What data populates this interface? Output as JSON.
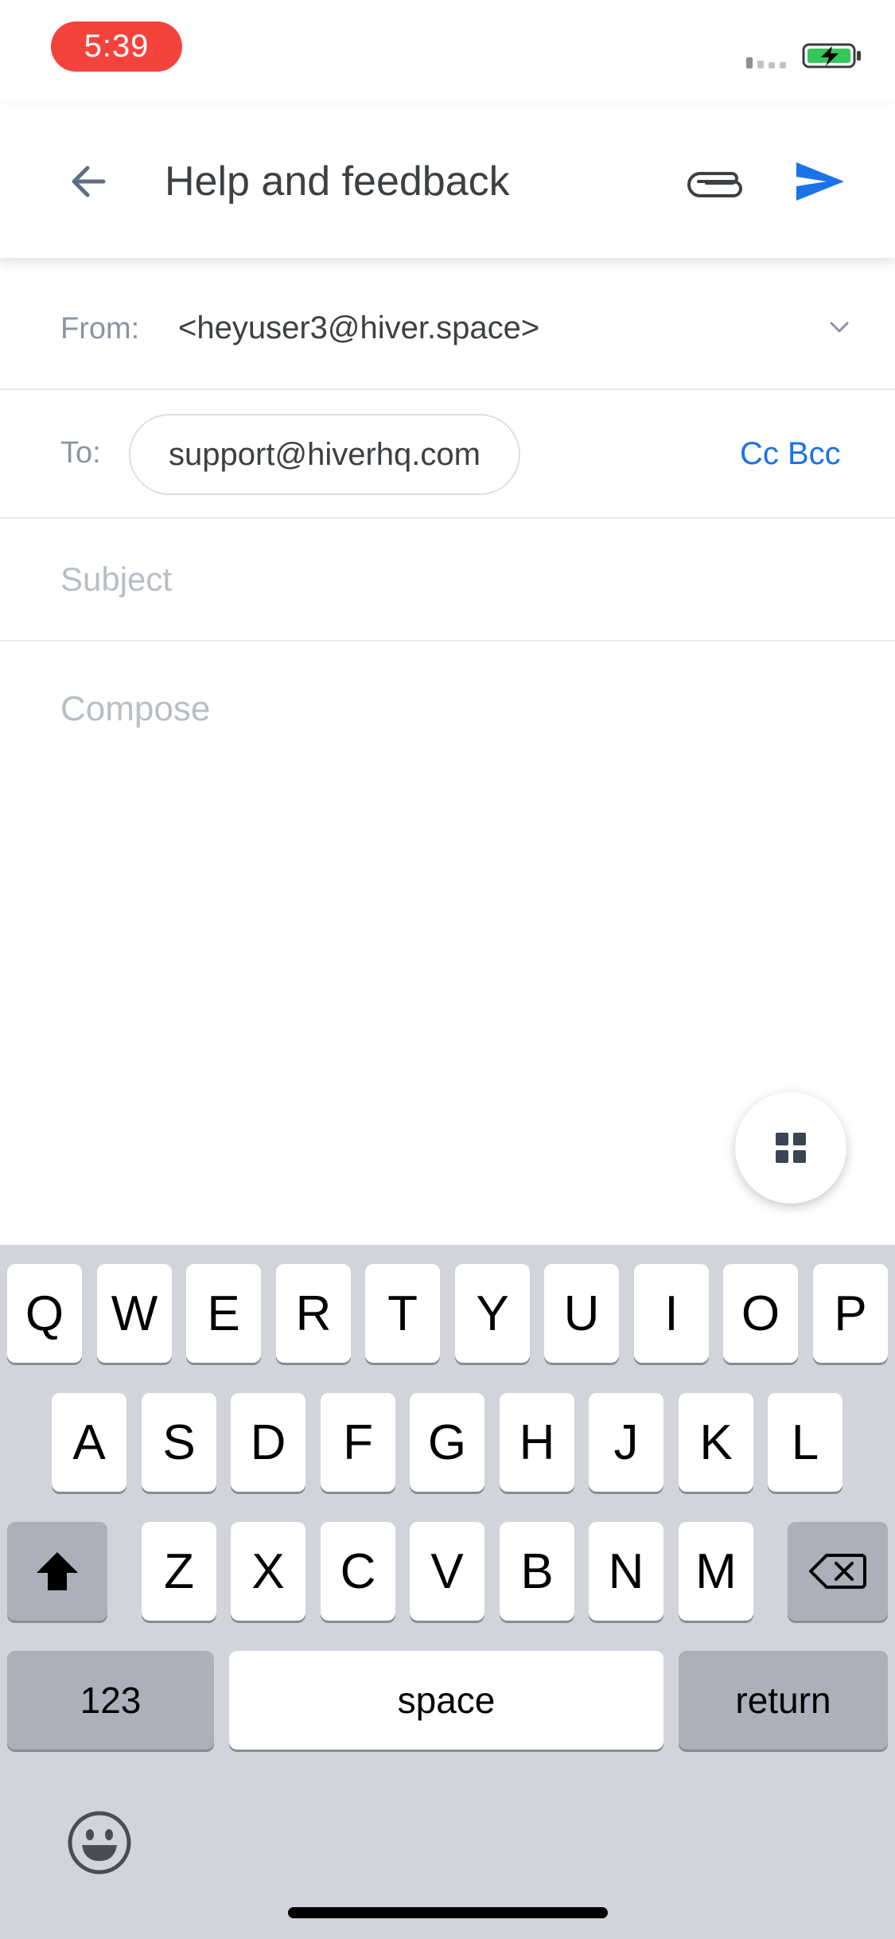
{
  "status_bar": {
    "time": "5:39"
  },
  "app_bar": {
    "title": "Help and feedback"
  },
  "from": {
    "label": "From:",
    "value": "<heyuser3@hiver.space>"
  },
  "to": {
    "label": "To:",
    "recipient": "support@hiverhq.com",
    "cc_bcc": "Cc Bcc"
  },
  "subject": {
    "placeholder": "Subject"
  },
  "compose": {
    "placeholder": "Compose"
  },
  "keyboard": {
    "row1": [
      "Q",
      "W",
      "E",
      "R",
      "T",
      "Y",
      "U",
      "I",
      "O",
      "P"
    ],
    "row2": [
      "A",
      "S",
      "D",
      "F",
      "G",
      "H",
      "J",
      "K",
      "L"
    ],
    "row3": [
      "Z",
      "X",
      "C",
      "V",
      "B",
      "N",
      "M"
    ],
    "numbers_label": "123",
    "space_label": "space",
    "return_label": "return"
  },
  "colors": {
    "accent": "#1a73e8",
    "time_pill": "#f4433c",
    "battery": "#34c759",
    "keyboard_bg": "#d1d4da"
  }
}
